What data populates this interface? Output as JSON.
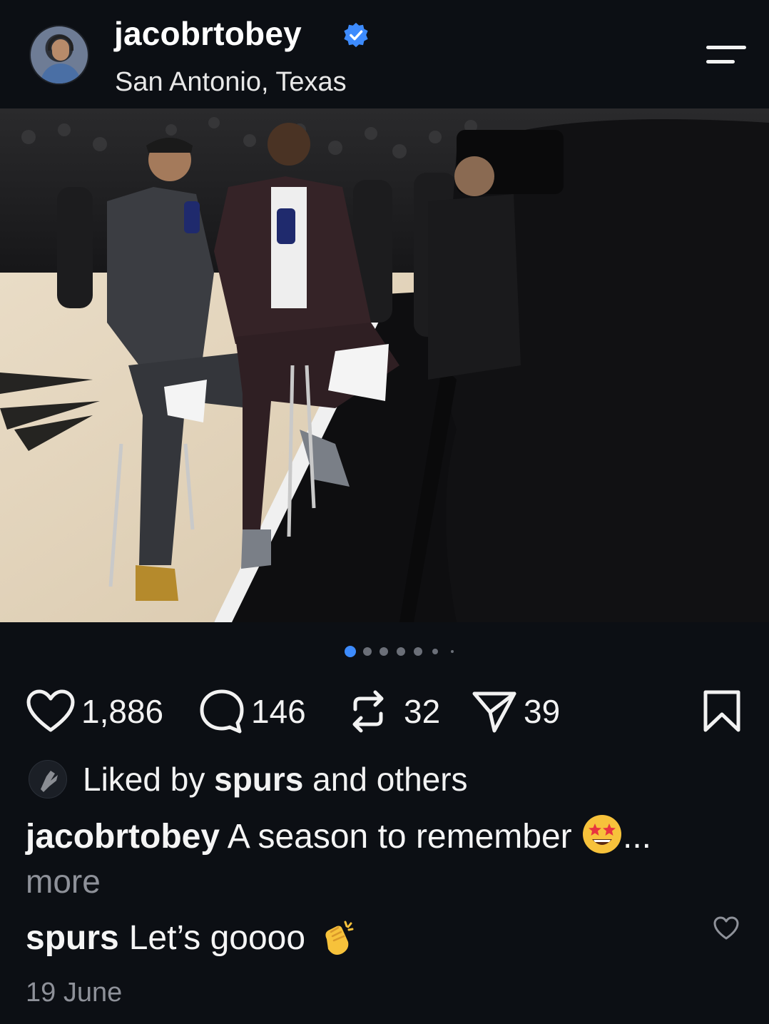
{
  "post": {
    "username": "jacobrtobey",
    "location": "San Antonio, Texas",
    "verified": true,
    "carousel": {
      "total": 8,
      "active": 1
    },
    "likes": "1,886",
    "comments": "146",
    "reposts": "32",
    "shares": "39",
    "liked_by": {
      "prefix": "Liked by ",
      "user": "spurs",
      "suffix": " and others"
    },
    "caption": {
      "user": "jacobrtobey",
      "text": "A season to remember",
      "ellipsis": "...",
      "more": "more"
    },
    "top_comment": {
      "user": "spurs",
      "text": "Let’s goooo"
    },
    "date": "19 June"
  },
  "icons": {
    "menu": "menu-icon",
    "like": "heart-icon",
    "comment": "comment-icon",
    "repost": "repost-icon",
    "share": "send-icon",
    "save": "bookmark-icon",
    "verified": "verified-badge-icon"
  },
  "colors": {
    "background": "#0c0f14",
    "accent": "#3d8bfd",
    "muted": "#8e9199"
  }
}
